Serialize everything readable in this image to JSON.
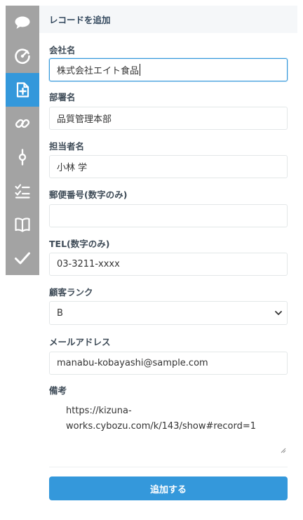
{
  "sidebar": {
    "items": [
      {
        "icon": "speech-bubble-icon",
        "active": false
      },
      {
        "icon": "gauge-icon",
        "active": false
      },
      {
        "icon": "add-document-icon",
        "active": true
      },
      {
        "icon": "link-icon",
        "active": false
      },
      {
        "icon": "commit-icon",
        "active": false
      },
      {
        "icon": "checklist-icon",
        "active": false
      },
      {
        "icon": "book-icon",
        "active": false
      },
      {
        "icon": "check-icon",
        "active": false
      }
    ],
    "background": "#a3a3a3",
    "active_color": "#3498db"
  },
  "panel": {
    "title": "レコードを追加"
  },
  "form": {
    "company": {
      "label": "会社名",
      "value": "株式会社エイト食品"
    },
    "department": {
      "label": "部署名",
      "value": "品質管理本部"
    },
    "contact": {
      "label": "担当者名",
      "value": "小林 学"
    },
    "postal": {
      "label": "郵便番号(数字のみ)",
      "value": ""
    },
    "tel": {
      "label": "TEL(数字のみ)",
      "value": "03-3211-xxxx"
    },
    "rank": {
      "label": "顧客ランク",
      "value": "B"
    },
    "email": {
      "label": "メールアドレス",
      "value": "manabu-kobayashi@sample.com"
    },
    "notes": {
      "label": "備考",
      "value": "https://kizuna-works.cybozu.com/k/143/show#record=1"
    }
  },
  "submit": {
    "label": "追加する"
  }
}
